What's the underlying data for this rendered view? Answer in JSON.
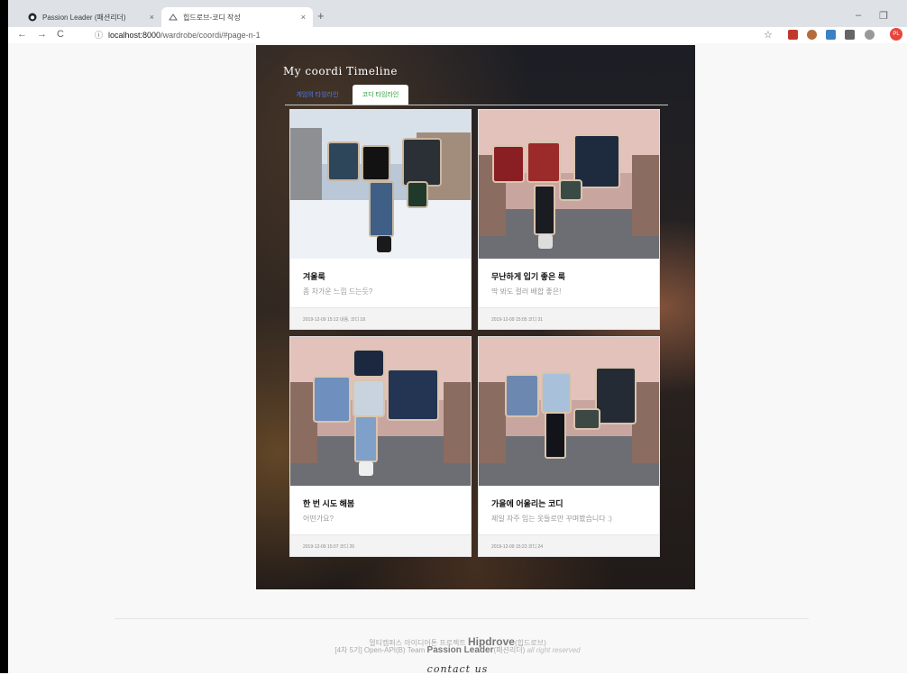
{
  "browser": {
    "tabs": [
      {
        "label": "Passion Leader (패션리더)",
        "icon": "github-icon",
        "close": "×"
      },
      {
        "label": "힙드로브-코디 작성",
        "icon": "hipdrove-logo-icon",
        "close": "×"
      }
    ],
    "new_tab": "+",
    "url_host": "localhost:8000",
    "url_path": "/wardrobe/coordi/#page-n-1"
  },
  "page": {
    "title": "My coordi Timeline",
    "tabs": [
      {
        "label": "게임의 타임라인"
      },
      {
        "label": "코디 타임라인"
      }
    ],
    "cards": [
      {
        "title": "겨울룩",
        "text": "좀 차가운 느낌 드는듯?",
        "date": "2019-12-09 15:12 내용, 코디 18"
      },
      {
        "title": "무난하게 입기 좋은 룩",
        "text": "딱 봐도 컬러 배합 좋은!",
        "date": "2019-12-09 15:05 코디 31"
      },
      {
        "title": "한 번 시도 해봄",
        "text": "어떤가요?",
        "date": "2019-12-09 15:07 코디 26"
      },
      {
        "title": "가을에 어울리는 코디",
        "text": "제일 자주 입는 옷들로만 꾸며봤습니다 :)",
        "date": "2019-12-09 15:23 코디 24"
      }
    ]
  },
  "footer": {
    "line1_prefix": "멀티캠퍼스 아이디어톤 프로젝트 ",
    "line1_brand": "Hipdrove",
    "line1_suffix": "(힙드로브)",
    "line2_prefix": "[4차 5기] Open-API(B) Team ",
    "line2_brand": "Passion Leader",
    "line2_suffix": "(패션리더) ",
    "line2_rights": "all right reserved",
    "contact": "contact us"
  },
  "colors": {
    "tab_blue": "#4a7bf7",
    "tab_green": "#2a9d3b",
    "hero_bg": "#1c1e25"
  }
}
